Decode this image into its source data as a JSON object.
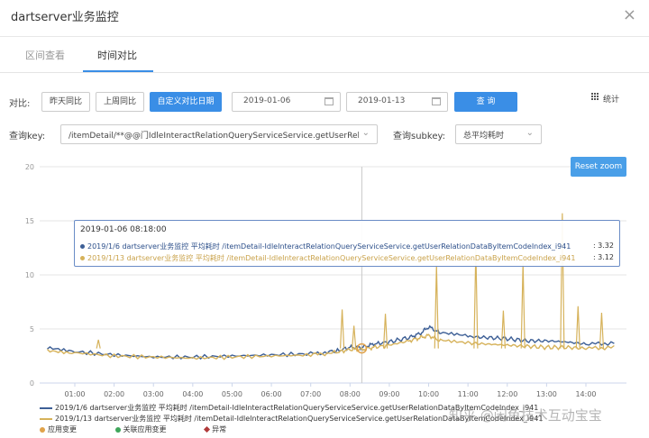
{
  "window": {
    "title": "dartserver业务监控",
    "close_glyph": "×"
  },
  "tabs": [
    {
      "label": "区间查看",
      "active": false
    },
    {
      "label": "时间对比",
      "active": true
    }
  ],
  "toolbar": {
    "compare_label": "对比:",
    "btn_yesterday": "昨天同比",
    "btn_lastweek": "上周同比",
    "btn_custom": "自定义对比日期",
    "date1": "2019-01-06",
    "date2": "2019-01-13",
    "btn_query": "查 询",
    "stats_label": "统计"
  },
  "filters": {
    "querykey_label": "查询key:",
    "querykey_value": "/itemDetail/**@@门IdleInteractRelationQueryServiceService.getUserRelatio...",
    "subkey_label": "查询subkey:",
    "subkey_value": "总平均耗时"
  },
  "chart": {
    "reset_zoom_label": "Reset zoom",
    "tooltip": {
      "time": "2019-01-06 08:18:00",
      "row1_text": "2019/1/6 dartserver业务监控 平均耗时 /itemDetail-IdleInteractRelationQueryServiceService.getUserRelationDataByItemCodeIndex_i941",
      "row1_value": ": 3.32",
      "row2_text": "2019/1/13 dartserver业务监控 平均耗时 /itemDetail-IdleInteractRelationQueryServiceService.getUserRelationDataByItemCodeIndex_i941",
      "row2_value": ": 3.12"
    }
  },
  "legend": {
    "series1": "2019/1/6 dartserver业务监控 平均耗时 /itemDetail-IdleInteractRelationQueryServiceService.getUserRelationDataByItemCodeIndex_i941",
    "series2": "2019/1/13 dartserver业务监控 平均耗时 /itemDetail-IdleInteractRelationQueryServiceService.getUserRelationDataByItemCodeIndex_i941",
    "m1": "应用变更",
    "m2": "关联应用变更",
    "m3": "异常"
  },
  "watermark": "知乎 @闲鱼技术互动宝宝",
  "colors": {
    "accent": "#3a8ee6",
    "series1": "#3d5f96",
    "series2": "#d6b25a",
    "m1": "#e0a24a",
    "m2": "#3fa65b",
    "m3": "#b03a3a"
  },
  "chart_data": {
    "type": "line",
    "yticks": [
      0,
      5,
      10,
      15,
      20
    ],
    "ylim": [
      0,
      20
    ],
    "xticks": [
      "01:00",
      "02:00",
      "03:00",
      "04:00",
      "05:00",
      "06:00",
      "07:00",
      "08:00",
      "09:00",
      "10:00",
      "11:00",
      "12:00",
      "13:00",
      "14:00"
    ],
    "x_hours": [
      0.3,
      1,
      2,
      3,
      4,
      5,
      6,
      7,
      7.6,
      8,
      8.3,
      8.6,
      9,
      9.5,
      9.8,
      10,
      10.3,
      11,
      11.5,
      12,
      12.5,
      13,
      13.5,
      14,
      14.8
    ],
    "series": [
      {
        "name": "2019/1/6 dartserver业务监控 平均耗时",
        "values": [
          3.2,
          2.9,
          2.6,
          2.4,
          2.4,
          2.5,
          2.6,
          2.7,
          2.9,
          3.3,
          3.3,
          3.6,
          3.8,
          4.2,
          4.6,
          5.2,
          4.6,
          4.3,
          4.2,
          4.1,
          3.9,
          3.9,
          3.8,
          3.6,
          3.7
        ]
      },
      {
        "name": "2019/1/13 dartserver业务监控 平均耗时",
        "values": [
          3.0,
          2.8,
          2.5,
          2.4,
          2.3,
          2.4,
          2.5,
          2.6,
          2.8,
          3.1,
          3.1,
          3.3,
          3.5,
          3.9,
          4.2,
          4.4,
          3.9,
          3.7,
          3.6,
          3.5,
          3.4,
          3.3,
          3.3,
          3.2,
          3.3
        ]
      }
    ],
    "spikes": [
      {
        "x": 1.6,
        "y": 4.0
      },
      {
        "x": 7.8,
        "y": 6.8
      },
      {
        "x": 8.1,
        "y": 5.3
      },
      {
        "x": 8.9,
        "y": 6.4
      },
      {
        "x": 10.2,
        "y": 10.9
      },
      {
        "x": 11.2,
        "y": 12.4
      },
      {
        "x": 11.9,
        "y": 6.7
      },
      {
        "x": 12.4,
        "y": 11.1
      },
      {
        "x": 13.4,
        "y": 15.7
      },
      {
        "x": 13.8,
        "y": 7.1
      },
      {
        "x": 14.4,
        "y": 6.5
      }
    ]
  }
}
